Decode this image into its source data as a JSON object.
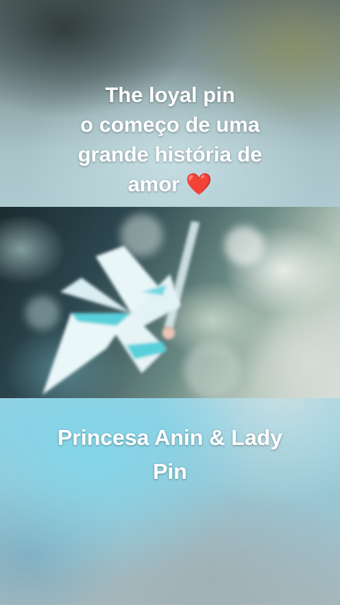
{
  "top_caption": {
    "line1": "The loyal pin",
    "line2": "o começo de uma",
    "line3": "grande história de",
    "line4": "amor",
    "emoji": "❤️"
  },
  "bottom_caption": {
    "line1": "Princesa Anin & Lady",
    "line2": "Pin"
  },
  "photo": {
    "subject": "pinwheel-icon"
  },
  "colors": {
    "text": "#ffffff",
    "heart": "#e0202a",
    "pinwheel": "#e8f6f8",
    "pinwheel_accent": "#3fc9d6"
  }
}
